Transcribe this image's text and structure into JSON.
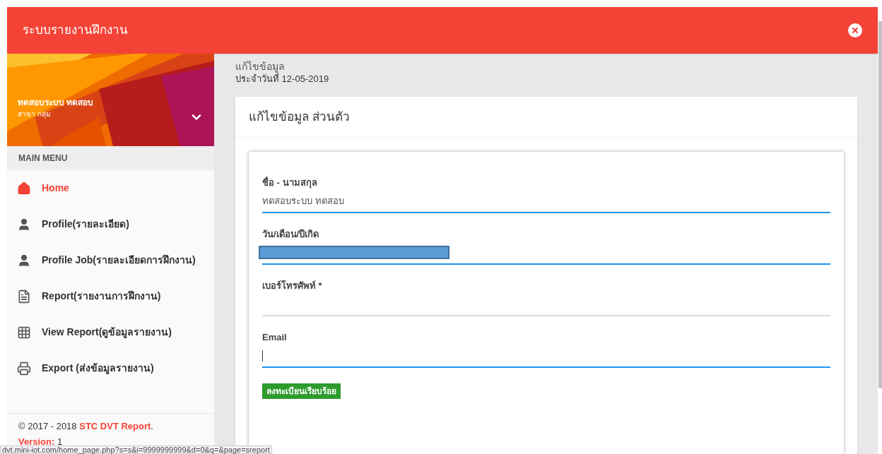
{
  "header": {
    "title": "ระบบรายงานฝึกงาน"
  },
  "user": {
    "name": "ทดสอบระบบ ทดสอบ",
    "group": "สาขา กลุ่ม"
  },
  "menu": {
    "heading": "MAIN MENU",
    "items": [
      {
        "kind": "home",
        "label": "Home",
        "selected": true
      },
      {
        "kind": "person",
        "label": "Profile(รายละเอียด)",
        "selected": false
      },
      {
        "kind": "person",
        "label": "Profile Job(รายละเอียดการฝึกงาน)",
        "selected": false
      },
      {
        "kind": "file",
        "label": "Report(รายงานการฝึกงาน)",
        "selected": false
      },
      {
        "kind": "grid",
        "label": "View Report(ดูข้อมูลรายงาน)",
        "selected": false
      },
      {
        "kind": "printer",
        "label": "Export (ส่งข้อมูลรายงาน)",
        "selected": false
      }
    ]
  },
  "footer": {
    "copyright": "© 2017 - 2018",
    "brand": "STC DVT Report",
    "brand_suffix": ".",
    "version_label": "Version:",
    "version": "1"
  },
  "page": {
    "title": "แก้ไขข้อมูล",
    "date": "ประจำวันที่ 12-05-2019"
  },
  "card": {
    "title": "แก้ไขข้อมูล ส่วนตัว",
    "fields": [
      {
        "kind": "text",
        "label": "ชื่อ - นามสกุล",
        "value": "ทดสอบระบบ ทดสอบ",
        "highlighted": true,
        "cursor": false
      },
      {
        "kind": "redacted",
        "label": "วัน/เดือน/ปีเกิด",
        "highlighted": true,
        "cursor": false
      },
      {
        "kind": "text",
        "label": "เบอร์โทรศัพท์ *",
        "highlighted": false,
        "cursor": false
      },
      {
        "kind": "text",
        "label": "Email",
        "highlighted": true,
        "cursor": true
      }
    ],
    "status_badge": "ลงทะเบียนเรียบร้อย"
  },
  "status_bar": {
    "url": "dvt.mini-iot.com/home_page.php?s=s&i=9999999999&d=0&q=&page=sreport"
  }
}
